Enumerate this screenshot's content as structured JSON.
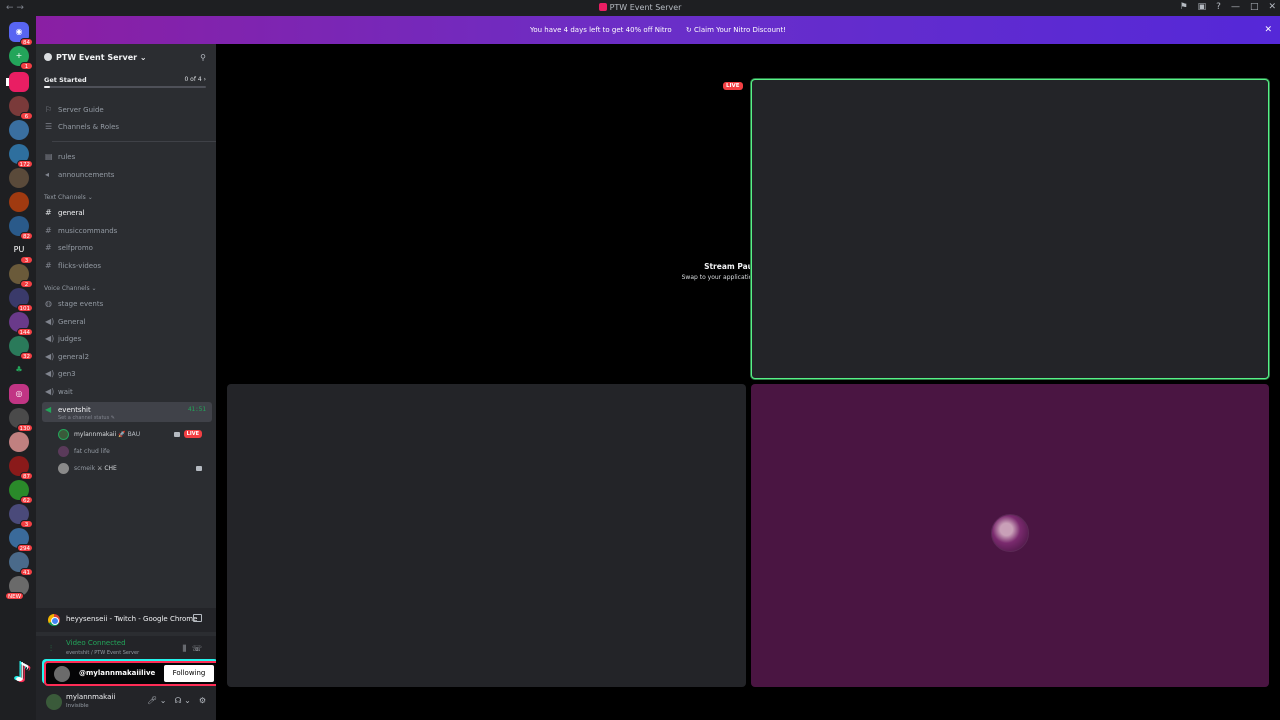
{
  "window": {
    "title": "PTW Event Server",
    "controls": [
      "flag-icon",
      "screen-icon",
      "help-icon",
      "minimize-icon",
      "maximize-icon",
      "close-icon"
    ]
  },
  "banner": {
    "text": "You have 4 days left to get 40% off Nitro",
    "claim_label": "Claim Your Nitro Discount!"
  },
  "rail": {
    "servers": [
      {
        "name": "home",
        "badge": "84"
      },
      {
        "name": "add-friend",
        "badge": "1"
      },
      {
        "name": "ptw-event-server",
        "badge": ""
      },
      {
        "name": "server-4",
        "badge": "6"
      },
      {
        "name": "server-5",
        "badge": ""
      },
      {
        "name": "server-6",
        "badge": "172"
      },
      {
        "name": "server-7",
        "badge": ""
      },
      {
        "name": "server-8",
        "badge": ""
      },
      {
        "name": "server-9",
        "badge": "82"
      },
      {
        "name": "server-pu",
        "badge": "3",
        "label": "PU"
      },
      {
        "name": "server-11",
        "badge": "2"
      },
      {
        "name": "server-12",
        "badge": "101"
      },
      {
        "name": "server-13",
        "badge": "144"
      },
      {
        "name": "server-14",
        "badge": "32"
      },
      {
        "name": "server-15",
        "badge": ""
      },
      {
        "name": "server-16",
        "badge": ""
      },
      {
        "name": "server-17",
        "badge": "130"
      },
      {
        "name": "server-18",
        "badge": ""
      },
      {
        "name": "server-19",
        "badge": "87"
      },
      {
        "name": "server-20",
        "badge": "62"
      },
      {
        "name": "server-21",
        "badge": "3"
      },
      {
        "name": "server-22",
        "badge": "294"
      },
      {
        "name": "server-23",
        "badge": "41"
      },
      {
        "name": "server-24",
        "badge": "NEW"
      }
    ]
  },
  "sidebar": {
    "server_name": "PTW Event Server",
    "get_started": {
      "label": "Get Started",
      "progress": "0 of 4",
      "fraction": 0.04
    },
    "guide": [
      {
        "label": "Server Guide"
      },
      {
        "label": "Channels & Roles"
      }
    ],
    "top_channels": [
      {
        "label": "rules"
      },
      {
        "label": "announcements"
      }
    ],
    "text_category": "Text Channels",
    "text_channels": [
      {
        "label": "general",
        "active": true
      },
      {
        "label": "musiccommands"
      },
      {
        "label": "selfpromo"
      },
      {
        "label": "flicks-videos"
      }
    ],
    "voice_category": "Voice Channels",
    "voice_channels": [
      {
        "label": "stage events"
      },
      {
        "label": "General"
      },
      {
        "label": "judges"
      },
      {
        "label": "general2"
      },
      {
        "label": "gen3"
      },
      {
        "label": "wait"
      }
    ],
    "active_voice": {
      "label": "eventshit",
      "timer": "41:51",
      "status": "Set a channel status"
    },
    "members": [
      {
        "name": "mylannmakaii",
        "tag": "BAU",
        "live": "LIVE"
      },
      {
        "name": "fat chud life"
      },
      {
        "name": "scmeik",
        "tag": "CHE"
      }
    ]
  },
  "activity": {
    "label": "heyysenseii - Twitch - Google Chrome"
  },
  "voice_panel": {
    "status": "Video Connected",
    "location": "eventshit / PTW Event Server"
  },
  "user_panel": {
    "name": "mylannmakaii",
    "status": "Invisible"
  },
  "tiktok": {
    "handle": "@mylannmakaiilive",
    "follow_label": "Following"
  },
  "stage": {
    "paused_title": "Stream Paused",
    "paused_sub": "Swap to your application to resume.",
    "live_label": "LIVE"
  }
}
